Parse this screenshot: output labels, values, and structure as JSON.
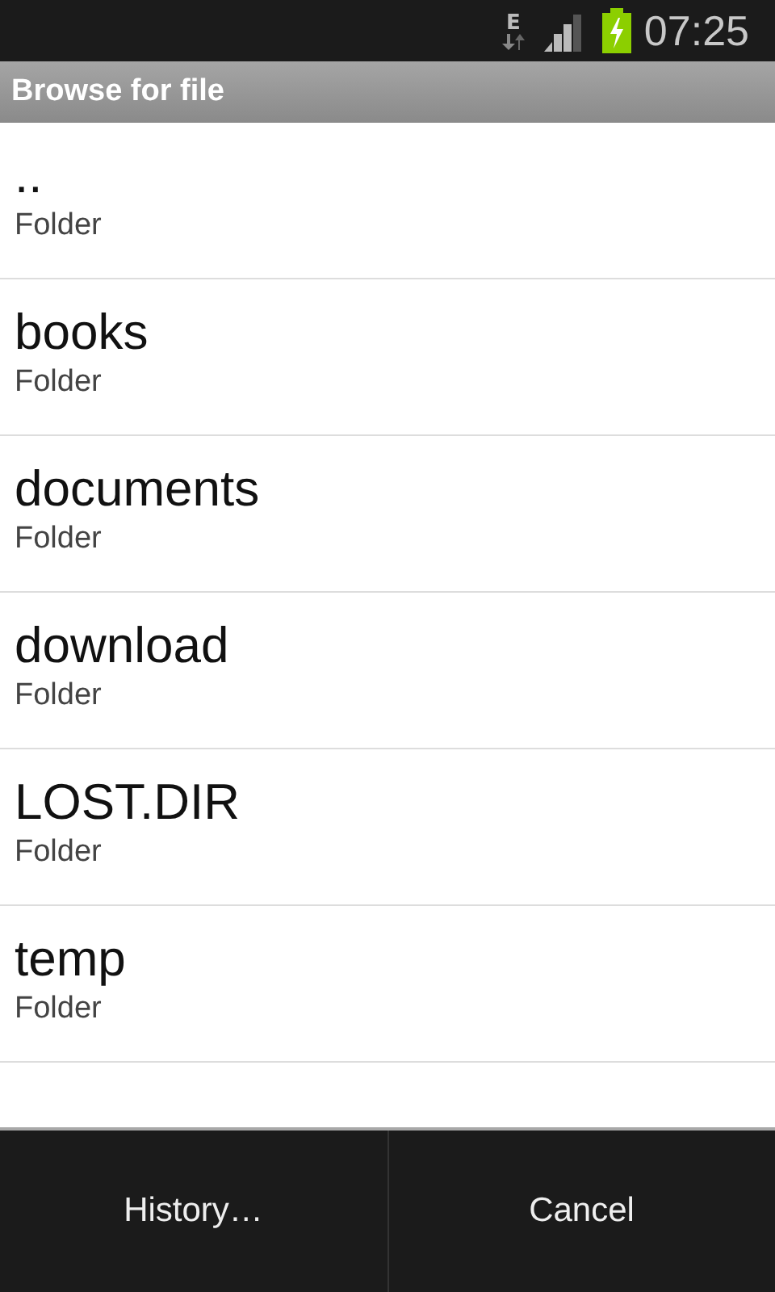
{
  "status_bar": {
    "network": "E",
    "time": "07:25"
  },
  "title": "Browse for file",
  "entries": [
    {
      "name": "..",
      "type": "Folder"
    },
    {
      "name": "books",
      "type": "Folder"
    },
    {
      "name": "documents",
      "type": "Folder"
    },
    {
      "name": "download",
      "type": "Folder"
    },
    {
      "name": "LOST.DIR",
      "type": "Folder"
    },
    {
      "name": "temp",
      "type": "Folder"
    }
  ],
  "buttons": [
    "History…",
    "Cancel"
  ]
}
